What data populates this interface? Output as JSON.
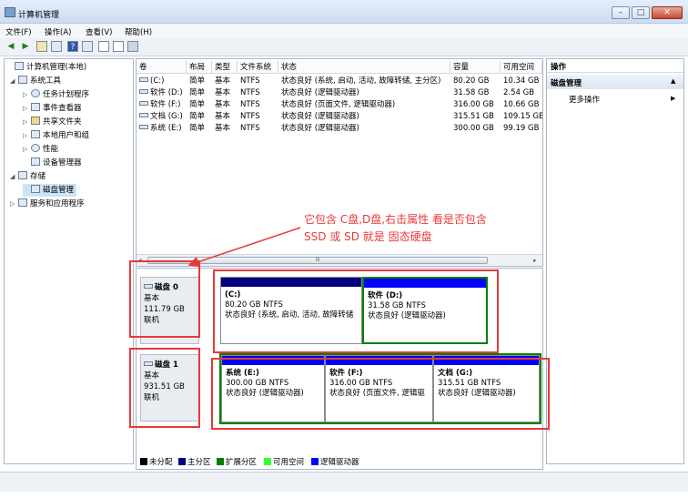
{
  "window": {
    "title": "计算机管理",
    "buttons": [
      "–",
      "□",
      "✕"
    ]
  },
  "menu": [
    "文件(F)",
    "操作(A)",
    "查看(V)",
    "帮助(H)"
  ],
  "toolbar": [
    "back-icon",
    "forward-icon",
    "up-folder-icon",
    "show-hide-tree-icon",
    "help-icon",
    "view-icon",
    "export-icon",
    "properties-icon",
    "settings-icon"
  ],
  "tree": [
    {
      "label": "计算机管理(本地)",
      "level": 0,
      "expander": "",
      "icon": "computer-icon"
    },
    {
      "label": "系统工具",
      "level": 1,
      "expander": "◢",
      "icon": "tools-icon"
    },
    {
      "label": "任务计划程序",
      "level": 2,
      "expander": "▷",
      "icon": "clock-icon"
    },
    {
      "label": "事件查看器",
      "level": 2,
      "expander": "▷",
      "icon": "event-viewer-icon"
    },
    {
      "label": "共享文件夹",
      "level": 2,
      "expander": "▷",
      "icon": "shared-folder-icon"
    },
    {
      "label": "本地用户和组",
      "level": 2,
      "expander": "▷",
      "icon": "users-icon"
    },
    {
      "label": "性能",
      "level": 2,
      "expander": "▷",
      "icon": "performance-icon"
    },
    {
      "label": "设备管理器",
      "level": 2,
      "expander": "",
      "icon": "device-manager-icon"
    },
    {
      "label": "存储",
      "level": 1,
      "expander": "◢",
      "icon": "storage-icon"
    },
    {
      "label": "磁盘管理",
      "level": 2,
      "expander": "",
      "icon": "disk-management-icon",
      "selected": true
    },
    {
      "label": "服务和应用程序",
      "level": 1,
      "expander": "▷",
      "icon": "services-icon"
    }
  ],
  "volumes": {
    "headers": [
      "卷",
      "布局",
      "类型",
      "文件系统",
      "状态",
      "容量",
      "可用空间"
    ],
    "rows": [
      [
        "(C:)",
        "简单",
        "基本",
        "NTFS",
        "状态良好 (系统, 启动, 活动, 故障转储, 主分区)",
        "80.20 GB",
        "10.34 GB"
      ],
      [
        "软件 (D:)",
        "简单",
        "基本",
        "NTFS",
        "状态良好 (逻辑驱动器)",
        "31.58 GB",
        "2.54 GB"
      ],
      [
        "软件 (F:)",
        "简单",
        "基本",
        "NTFS",
        "状态良好 (页面文件, 逻辑驱动器)",
        "316.00 GB",
        "10.66 GB"
      ],
      [
        "文档 (G:)",
        "简单",
        "基本",
        "NTFS",
        "状态良好 (逻辑驱动器)",
        "315.51 GB",
        "109.15 GE"
      ],
      [
        "系统 (E:)",
        "简单",
        "基本",
        "NTFS",
        "状态良好 (逻辑驱动器)",
        "300.00 GB",
        "99.19 GB"
      ]
    ],
    "scroll_grip": "III"
  },
  "disks": [
    {
      "name": "磁盘 0",
      "type": "基本",
      "size": "111.79 GB",
      "status": "联机",
      "partitions": [
        {
          "label": "(C:)",
          "size": "80.20 GB NTFS",
          "status": "状态良好 (系统, 启动, 活动, 故障转储"
        },
        {
          "label": "软件  (D:)",
          "size": "31.58 GB NTFS",
          "status": "状态良好 (逻辑驱动器)"
        }
      ]
    },
    {
      "name": "磁盘 1",
      "type": "基本",
      "size": "931.51 GB",
      "status": "联机",
      "partitions": [
        {
          "label": "系统  (E:)",
          "size": "300.00 GB NTFS",
          "status": "状态良好 (逻辑驱动器)"
        },
        {
          "label": "软件  (F:)",
          "size": "316.00 GB NTFS",
          "status": "状态良好 (页面文件, 逻辑驱"
        },
        {
          "label": "文档  (G:)",
          "size": "315.51 GB NTFS",
          "status": "状态良好 (逻辑驱动器)"
        }
      ]
    }
  ],
  "legend": [
    {
      "label": "未分配",
      "color": "#000000"
    },
    {
      "label": "主分区",
      "color": "#00007f"
    },
    {
      "label": "扩展分区",
      "color": "#008000"
    },
    {
      "label": "可用空间",
      "color": "#33ff33"
    },
    {
      "label": "逻辑驱动器",
      "color": "#0000ff"
    }
  ],
  "actions": {
    "header": "操作",
    "section": "磁盘管理",
    "more": "更多操作"
  },
  "annotation": {
    "text": "它包含 C盘,D盘,右击属性 看是否包含\nSSD 或 SD 就是 固态硬盘",
    "color": "#e8393a"
  },
  "colors": {
    "primary_partition": "#00007f",
    "logical_drive": "#0000ff",
    "extended_partition": "#008000",
    "selection": "#cce4f7"
  }
}
